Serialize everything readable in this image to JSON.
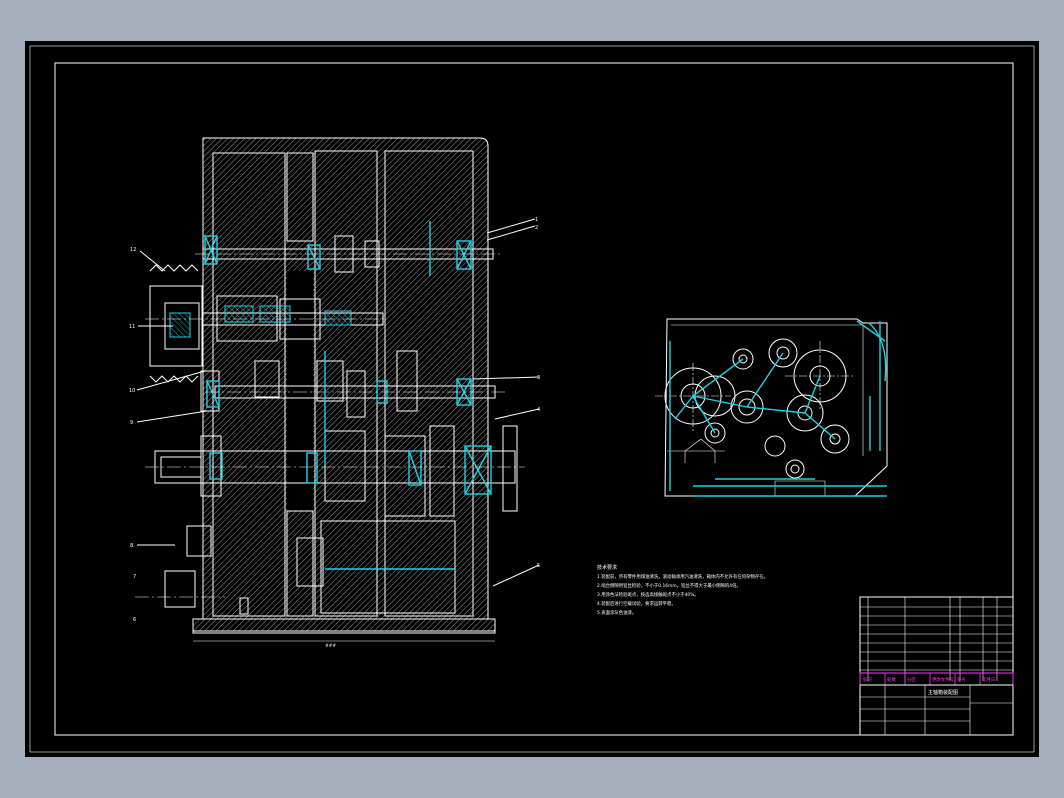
{
  "colors": {
    "background": "#000000",
    "lines": "#ffffff",
    "dimension": "#19d3e6",
    "title_block_accent": "#ff33ff",
    "frame": "#a6adbb"
  },
  "balloons": [
    "12",
    "11",
    "10",
    "9",
    "8",
    "7",
    "6",
    "5",
    "4",
    "3",
    "2",
    "1"
  ],
  "notes": {
    "heading": "技术要求",
    "lines": [
      "1.装配前，所有零件用煤油清洗，滚动轴承用汽油清洗，箱体内不允许有任何杂物存在。",
      "2.啮合侧隙用铅丝检验，不小于0.16mm，铅丝不得大于最小侧隙的4倍。",
      "3.用涂色法检验斑点，按齿高接触斑点不小于40%。",
      "4.装配后进行空载试验，要求运转平稳。",
      "5.表面涂灰色油漆。"
    ]
  },
  "title_block": {
    "drawing_name": "主轴箱装配图",
    "labels": [
      "标记",
      "处数",
      "分区",
      "更改文件号",
      "签名",
      "年月日"
    ]
  }
}
